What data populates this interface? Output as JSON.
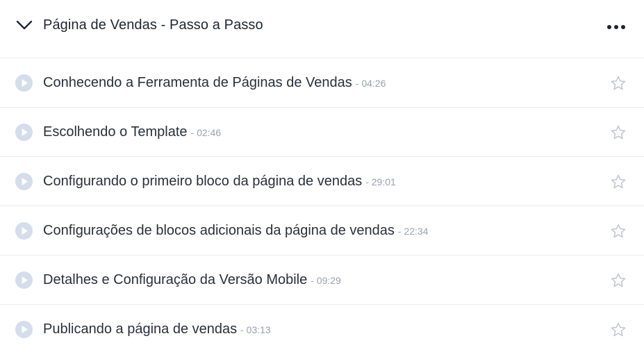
{
  "module": {
    "title": "Página de Vendas - Passo a Passo",
    "collapse_icon": "chevron-down-icon",
    "menu_icon": "more-horizontal-icon"
  },
  "lessons": [
    {
      "title": "Conhecendo a Ferramenta de Páginas de Vendas",
      "duration": "- 04:26"
    },
    {
      "title": "Escolhendo o Template",
      "duration": "- 02:46"
    },
    {
      "title": "Configurando o primeiro bloco da página de vendas",
      "duration": "- 29:01"
    },
    {
      "title": "Configurações de blocos adicionais da página de vendas",
      "duration": "- 22:34"
    },
    {
      "title": "Detalhes e Configuração da Versão Mobile",
      "duration": "- 09:29"
    },
    {
      "title": "Publicando a página de vendas",
      "duration": "- 03:13"
    }
  ],
  "colors": {
    "play_icon_fill": "#d4dde9",
    "play_icon_triangle": "#ffffff",
    "star_outline": "#c3c8d0",
    "divider": "#ececf0",
    "title_text": "#1f2430",
    "duration_text": "#9aa1ad"
  }
}
